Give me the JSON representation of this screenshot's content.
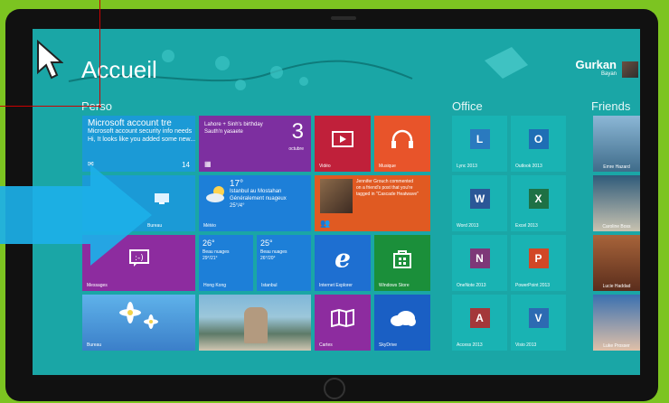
{
  "start": {
    "title": "Accueil"
  },
  "groups": {
    "perso": "Perso",
    "office": "Office",
    "friends": "Friends"
  },
  "user": {
    "name": "Gurkan",
    "sub": "Bayan"
  },
  "tiles": {
    "mail": {
      "line1": "Microsoft account tre",
      "line2": "Microsoft account security info needs",
      "line3": "Hi, It looks like you added some new...",
      "count": "14"
    },
    "calendar": {
      "text": "Lahore + Sinh's birthday Sauth'n yasaete",
      "day": "3",
      "month": "octubre"
    },
    "video": {
      "label": "Vidéo"
    },
    "music": {
      "label": "Musique"
    },
    "desktop": {
      "label": "Bureau"
    },
    "weather": {
      "temp": "17°",
      "city": "Istanbul au Mostahan",
      "cond": "Généralement nuageux",
      "range": "25°/4°",
      "label": "Météo"
    },
    "people": {
      "text": "Jennifer Grouch commented on a friend's post that you're tagged in \"Cascade Heatwave\"",
      "label": ""
    },
    "messages": {
      "label": "Messages"
    },
    "hongkong": {
      "temp": "26°",
      "l1": "Beau nuages",
      "l2": "29°/21°",
      "label": "Hong Kong"
    },
    "istanbul": {
      "temp": "25°",
      "l1": "Beau nuages",
      "l2": "26°/20°",
      "label": "Istanbul"
    },
    "ie": {
      "label": "Internet Explorer"
    },
    "store": {
      "label": "Windows Store"
    },
    "maps": {
      "label": "Cartes"
    },
    "skydrive": {
      "label": "SkyDrive"
    },
    "photos": {
      "label": "Bureau"
    }
  },
  "office": [
    {
      "label": "Lync 2013",
      "letter": "L",
      "color": "#2a7abf"
    },
    {
      "label": "Outlook 2013",
      "letter": "O",
      "color": "#1f6eb5"
    },
    {
      "label": "Word 2013",
      "letter": "W",
      "color": "#2b5797"
    },
    {
      "label": "Excel 2013",
      "letter": "X",
      "color": "#1e7145"
    },
    {
      "label": "OneNote 2013",
      "letter": "N",
      "color": "#7e3878"
    },
    {
      "label": "PowerPoint 2013",
      "letter": "P",
      "color": "#d24726"
    },
    {
      "label": "Access 2013",
      "letter": "A",
      "color": "#a4373a"
    },
    {
      "label": "Visio 2013",
      "letter": "V",
      "color": "#2d6ab2"
    }
  ],
  "friends": [
    {
      "label": "Emre Hazard"
    },
    {
      "label": "Caroline Boss"
    },
    {
      "label": "Lucie Haddad"
    },
    {
      "label": "Luke Prosser"
    }
  ]
}
